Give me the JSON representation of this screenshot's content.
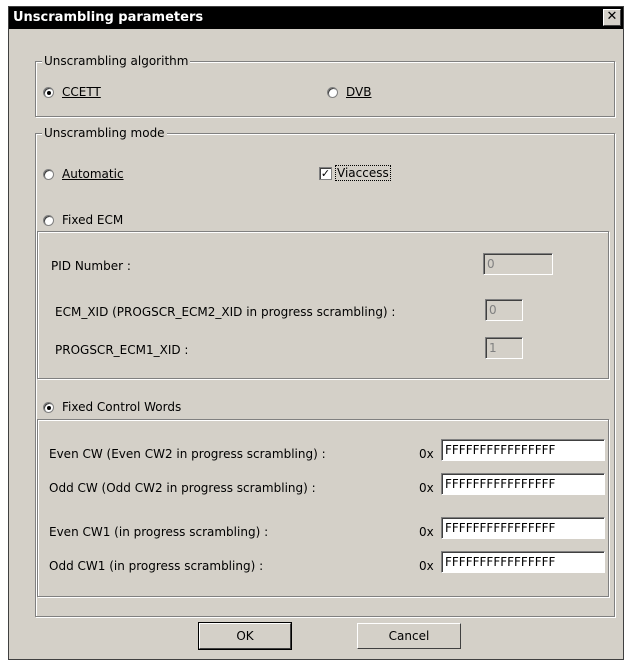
{
  "dialog": {
    "title": "Unscrambling parameters",
    "close_glyph": "✕"
  },
  "algorithm": {
    "group_title": "Unscrambling algorithm",
    "options": [
      {
        "label": "CCETT",
        "selected": true
      },
      {
        "label": "DVB",
        "selected": false
      }
    ]
  },
  "mode": {
    "group_title": "Unscrambling mode",
    "automatic_label": "Automatic",
    "automatic_selected": false,
    "viaccess_label": "Viaccess",
    "viaccess_checked": true,
    "fixed_ecm_label": "Fixed ECM",
    "fixed_ecm_selected": false,
    "fixed_cw_label": "Fixed Control Words",
    "fixed_cw_selected": true
  },
  "ecm": {
    "pid_label": "PID Number :",
    "pid_value": "0",
    "ecm_xid_label": "ECM_XID (PROGSCR_ECM2_XID in progress scrambling) :",
    "ecm_xid_value": "0",
    "ecm1_xid_label": "PROGSCR_ECM1_XID :",
    "ecm1_xid_value": "1"
  },
  "control_words": {
    "prefix": "0x",
    "rows": [
      {
        "label": "Even CW (Even CW2 in progress scrambling) :",
        "value": "FFFFFFFFFFFFFFFF"
      },
      {
        "label": "Odd CW (Odd CW2 in progress scrambling) :",
        "value": "FFFFFFFFFFFFFFFF"
      },
      {
        "label": "Even CW1 (in progress scrambling) :",
        "value": "FFFFFFFFFFFFFFFF"
      },
      {
        "label": "Odd CW1 (in progress scrambling) :",
        "value": "FFFFFFFFFFFFFFFF"
      }
    ]
  },
  "buttons": {
    "ok_label": "OK",
    "cancel_label": "Cancel"
  }
}
